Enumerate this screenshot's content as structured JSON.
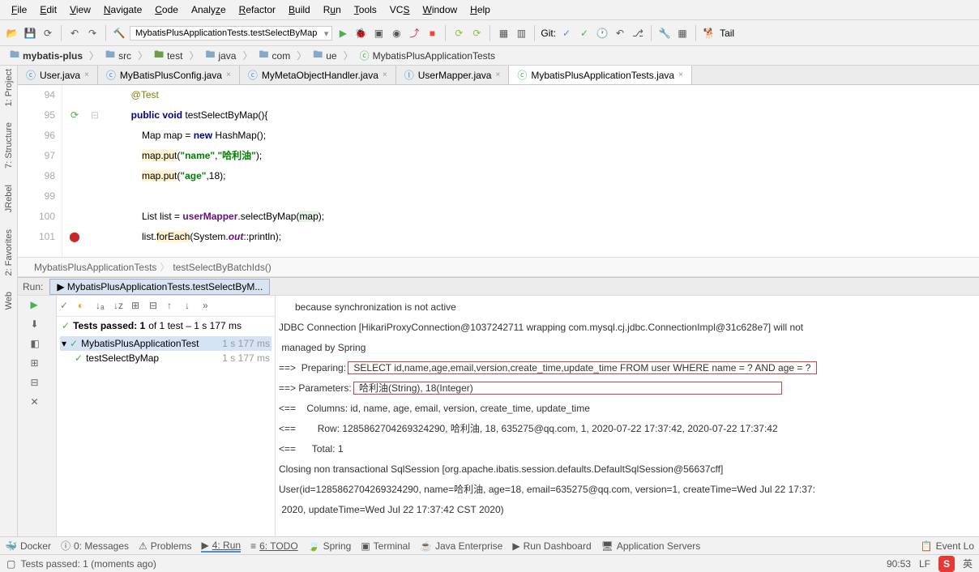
{
  "menubar": [
    "File",
    "Edit",
    "View",
    "Navigate",
    "Code",
    "Analyze",
    "Refactor",
    "Build",
    "Run",
    "Tools",
    "VCS",
    "Window",
    "Help"
  ],
  "toolbar": {
    "combo": "MybatisPlusApplicationTests.testSelectByMap",
    "git_label": "Git:",
    "tail_label": "Tail"
  },
  "breadcrumbs": [
    "mybatis-plus",
    "src",
    "test",
    "java",
    "com",
    "ue",
    "MybatisPlusApplicationTests"
  ],
  "tabs": [
    {
      "label": "User.java",
      "active": false
    },
    {
      "label": "MyBatisPlusConfig.java",
      "active": false
    },
    {
      "label": "MyMetaObjectHandler.java",
      "active": false
    },
    {
      "label": "UserMapper.java",
      "active": false
    },
    {
      "label": "MybatisPlusApplicationTests.java",
      "active": true
    }
  ],
  "code": {
    "lines": [
      94,
      95,
      96,
      97,
      98,
      99,
      100,
      101
    ],
    "l94": "@Test",
    "l95_public": "public",
    "l95_void": "void",
    "l95_rest": " testSelectByMap(){",
    "l96_a": "Map map = ",
    "l96_new": "new",
    "l96_b": " HashMap();",
    "l97_a": "map.",
    "l97_put": "put",
    "l97_b": "(",
    "l97_s1": "\"name\"",
    "l97_c": ",",
    "l97_s2": "\"哈利油\"",
    "l97_d": ");",
    "l98_a": "map.",
    "l98_put": "put",
    "l98_b": "(",
    "l98_s1": "\"age\"",
    "l98_c": ",18);",
    "l100_a": "List list = ",
    "l100_um": "userMapper",
    "l100_b": ".selectByMap(",
    "l100_map": "map",
    "l100_c": ");",
    "l101_a": "list.",
    "l101_fe": "forEach",
    "l101_b": "(System.",
    "l101_out": "out",
    "l101_c": "::println);"
  },
  "structure_crumbs": [
    "MybatisPlusApplicationTests",
    "testSelectByBatchIds()"
  ],
  "run": {
    "label": "Run:",
    "tab": "MybatisPlusApplicationTests.testSelectByM...",
    "status_prefix": "Tests passed: 1",
    "status_suffix": " of 1 test – 1 s 177 ms",
    "tree_root": "MybatisPlusApplicationTest",
    "tree_root_time": "1 s 177 ms",
    "tree_child": "testSelectByMap",
    "tree_child_time": "1 s 177 ms"
  },
  "console": {
    "l1": "      because synchronization is not active",
    "l2": "JDBC Connection [HikariProxyConnection@1037242711 wrapping com.mysql.cj.jdbc.ConnectionImpl@31c628e7] will not",
    "l3": " managed by Spring",
    "l4a": "==>  Preparing:",
    "l4b": " SELECT id,name,age,email,version,create_time,update_time FROM user WHERE name = ? AND age = ? ",
    "l5a": "==> Parameters:",
    "l5b": " 哈利油(String), 18(Integer)",
    "l6": "<==    Columns: id, name, age, email, version, create_time, update_time",
    "l7": "<==        Row: 1285862704269324290, 哈利油, 18, 635275@qq.com, 1, 2020-07-22 17:37:42, 2020-07-22 17:37:42",
    "l8": "<==      Total: 1",
    "l9": "Closing non transactional SqlSession [org.apache.ibatis.session.defaults.DefaultSqlSession@56637cff]",
    "l10": "User(id=1285862704269324290, name=哈利油, age=18, email=635275@qq.com, version=1, createTime=Wed Jul 22 17:37:",
    "l11": " 2020, updateTime=Wed Jul 22 17:37:42 CST 2020)"
  },
  "bottombar": {
    "docker": "Docker",
    "messages": "0: Messages",
    "problems": "Problems",
    "run": "4: Run",
    "todo": "6: TODO",
    "spring": "Spring",
    "terminal": "Terminal",
    "jee": "Java Enterprise",
    "rundash": "Run Dashboard",
    "appservers": "Application Servers",
    "eventlog": "Event Lo"
  },
  "statusbar": {
    "msg": "Tests passed: 1 (moments ago)",
    "pos": "90:53",
    "enc": "LF",
    "lang": "英"
  },
  "left_tools": {
    "project": "1: Project",
    "structure": "7: Structure",
    "favorites": "2: Favorites",
    "web": "Web",
    "jrebel": "JRebel"
  }
}
